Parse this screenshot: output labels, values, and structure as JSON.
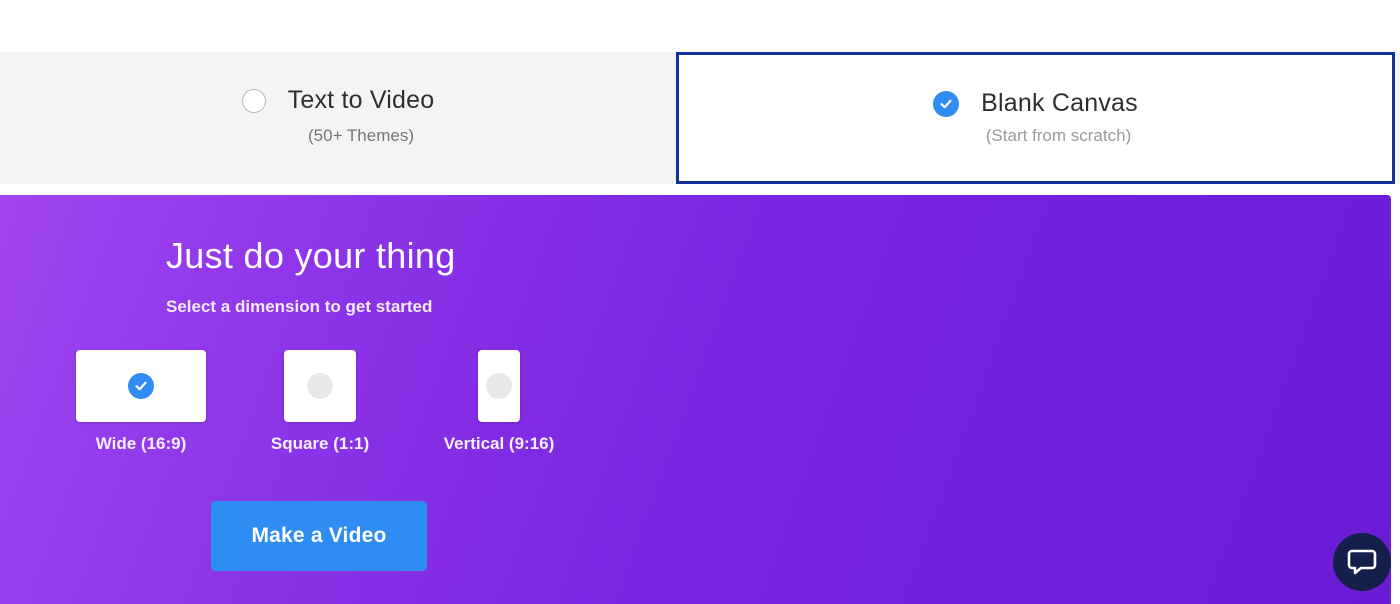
{
  "tabs": {
    "text_to_video": {
      "title": "Text to Video",
      "subtitle": "(50+ Themes)",
      "selected": false
    },
    "blank_canvas": {
      "title": "Blank Canvas",
      "subtitle": "(Start from scratch)",
      "selected": true
    }
  },
  "hero": {
    "title": "Just do your thing",
    "subtitle": "Select a dimension to get started"
  },
  "dimensions": [
    {
      "label": "Wide (16:9)",
      "selected": true
    },
    {
      "label": "Square (1:1)",
      "selected": false
    },
    {
      "label": "Vertical (9:16)",
      "selected": false
    }
  ],
  "actions": {
    "make_video_label": "Make a Video"
  },
  "icons": {
    "check": "check-icon",
    "chat": "chat-icon"
  },
  "colors": {
    "accent_blue": "#2f8cf2",
    "selected_border": "#12329a",
    "hero_gradient_start": "#a045f0",
    "hero_gradient_end": "#6a1bd4",
    "chat_bg": "#14204a"
  }
}
